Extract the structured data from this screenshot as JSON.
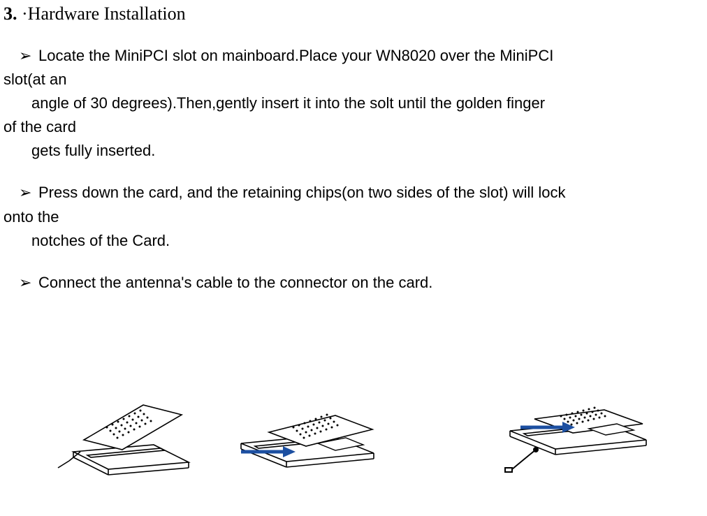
{
  "heading": {
    "number": "3.",
    "dot": "·",
    "title": "Hardware Installation"
  },
  "bullets": [
    {
      "marker": "➢",
      "line1a": "Locate the MiniPCI slot on mainboard.Place your WN8020 over the MiniPCI",
      "line1b": "slot(at an",
      "line2a": "angle  of 30 degrees).Then,gently insert it into the solt until the golden finger",
      "line2b": "of the card",
      "line3": "gets  fully inserted."
    },
    {
      "marker": "➢",
      "line1a": "Press down the card, and the retaining chips(on two sides of the slot) will lock",
      "line1b": "onto the",
      "line2": "notches of the Card."
    },
    {
      "marker": "➢",
      "line1": "Connect the antenna's cable to the connector on the card."
    }
  ],
  "diagrams": {
    "arrow_color": "#1C4FA1"
  }
}
